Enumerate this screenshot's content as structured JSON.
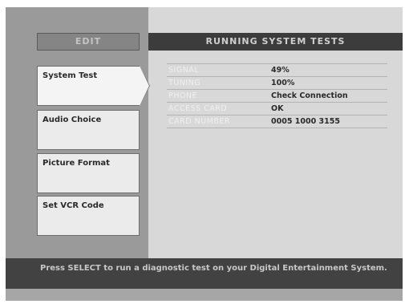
{
  "edit_label": "EDIT",
  "header_title": "RUNNING SYSTEM TESTS",
  "menu": [
    {
      "label": "System Test"
    },
    {
      "label": "Audio Choice"
    },
    {
      "label": "Picture Format"
    },
    {
      "label": "Set VCR Code"
    }
  ],
  "selected_menu_index": 0,
  "tests": [
    {
      "label": "SIGNAL",
      "value": "49%"
    },
    {
      "label": "TUNING",
      "value": "100%"
    },
    {
      "label": "PHONE",
      "value": "Check Connection"
    },
    {
      "label": "ACCESS CARD",
      "value": "OK"
    },
    {
      "label": "CARD NUMBER",
      "value": "0005 1000 3155"
    }
  ],
  "status_message": "Press SELECT to run a diagnostic test on your Digital Entertainment System."
}
